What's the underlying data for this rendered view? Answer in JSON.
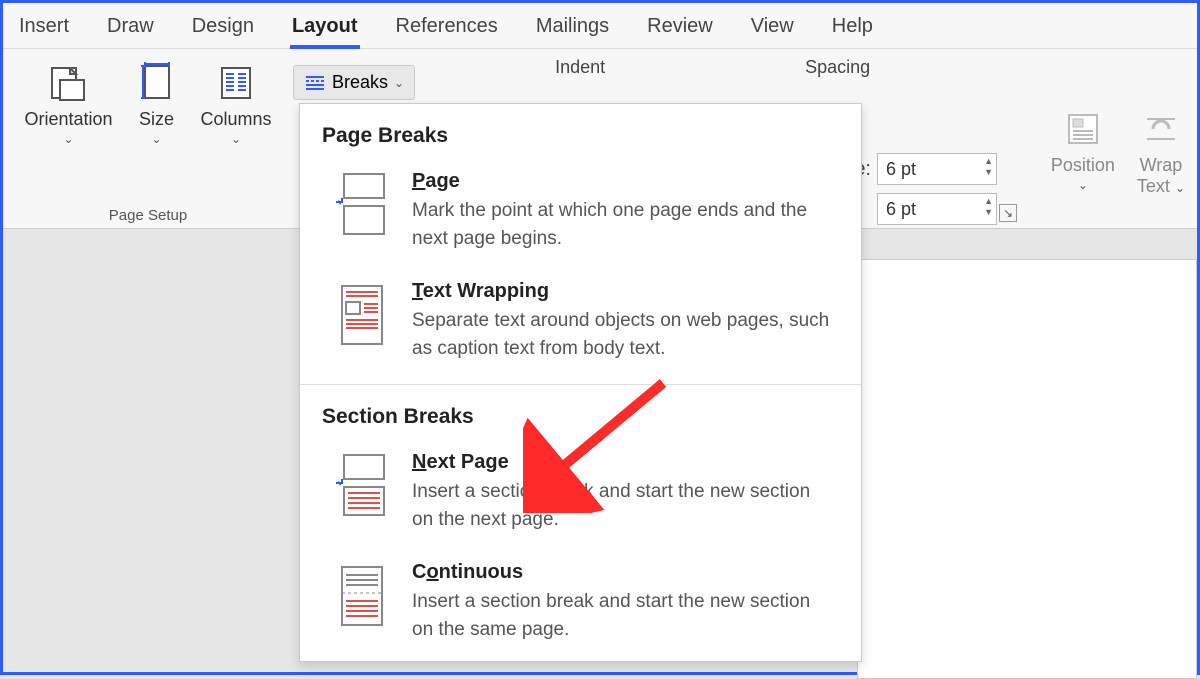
{
  "tabs": [
    "Insert",
    "Draw",
    "Design",
    "Layout",
    "References",
    "Mailings",
    "Review",
    "View",
    "Help"
  ],
  "active_tab": "Layout",
  "page_setup": {
    "orientation": "Orientation",
    "size": "Size",
    "columns": "Columns",
    "breaks_label": "Breaks",
    "group_name": "Page Setup"
  },
  "paragraph": {
    "indent_label": "Indent",
    "spacing_label": "Spacing",
    "before_suffix": "e:",
    "value_before": "6 pt",
    "value_after": "6 pt"
  },
  "arrange": {
    "position": "Position",
    "wrap": "Wrap",
    "wrap2": "Text"
  },
  "dropdown": {
    "section1_title": "Page Breaks",
    "page": {
      "title": "Page",
      "desc": "Mark the point at which one page ends and the next page begins."
    },
    "textwrap": {
      "title": "Text Wrapping",
      "desc": "Separate text around objects on web pages, such as caption text from body text."
    },
    "section2_title": "Section Breaks",
    "nextpage": {
      "title": "Next Page",
      "desc": "Insert a section break and start the new section on the next page."
    },
    "continuous": {
      "title": "Continuous",
      "desc": "Insert a section break and start the new section on the same page."
    }
  }
}
